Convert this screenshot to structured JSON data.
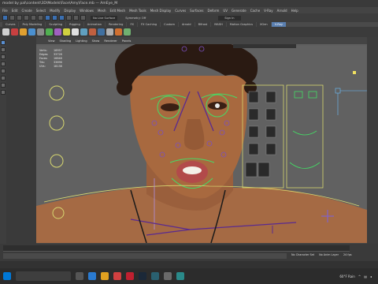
{
  "window": {
    "title": "model by pal\\content\\3D\\Models\\Face\\Amy\\Face.mb  —  AmEye_M"
  },
  "menus": [
    "File",
    "Edit",
    "Create",
    "Select",
    "Modify",
    "Display",
    "Windows",
    "Mesh",
    "Edit Mesh",
    "Mesh Tools",
    "Mesh Display",
    "Curves",
    "Surfaces",
    "Deform",
    "UV",
    "Generate",
    "Cache",
    "V-Ray",
    "Arnold",
    "Help"
  ],
  "statusline": {
    "no_live_surface": "No Live Surface",
    "symmetry": "Symmetry: Off",
    "sign_in": "Sign In"
  },
  "shelf_tabs": [
    "Curves",
    "Poly Modeling",
    "Sculpting",
    "Rigging",
    "Animation",
    "Rendering",
    "FX",
    "FX Caching",
    "Custom",
    "Arnold",
    "Bifrost",
    "MASH",
    "Motion Graphics",
    "XGen",
    "V-Ray"
  ],
  "active_shelf_tab": "V-Ray",
  "panel_menu": [
    "View",
    "Shading",
    "Lighting",
    "Show",
    "Renderer",
    "Panels"
  ],
  "hud": {
    "rows": [
      {
        "label": "Verts:",
        "value": "16957"
      },
      {
        "label": "Edges:",
        "value": "33728"
      },
      {
        "label": "Faces:",
        "value": "16848"
      },
      {
        "label": "Tris:",
        "value": "33696"
      },
      {
        "label": "UVs:",
        "value": "18138"
      }
    ]
  },
  "viewport_bar": {
    "camera": "sRGB gamma"
  },
  "timeline": {
    "character_set": "No Character Set",
    "anim_layer": "No Anim Layer",
    "fps": "24 fps"
  },
  "taskbar": {
    "weather": "60°F  Rain",
    "clock_time": "",
    "clock_date": ""
  },
  "colors": {
    "maya_bg": "#444444",
    "viewport_bg": "#616161",
    "accent": "#5a7fb0",
    "control_green": "#44dd66",
    "control_yellow": "#d8d870",
    "joint_purple": "#5a2a90"
  }
}
